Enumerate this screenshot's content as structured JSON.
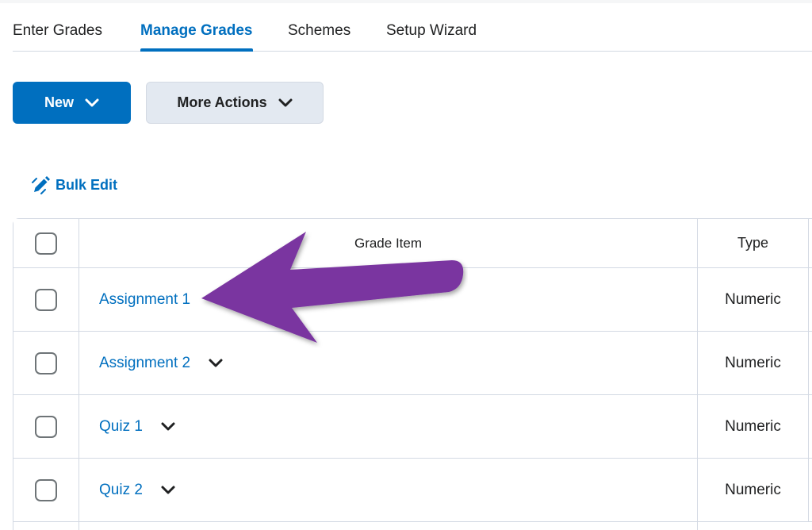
{
  "tabs": [
    {
      "label": "Enter Grades",
      "active": false
    },
    {
      "label": "Manage Grades",
      "active": true
    },
    {
      "label": "Schemes",
      "active": false
    },
    {
      "label": "Setup Wizard",
      "active": false
    }
  ],
  "toolbar": {
    "new_label": "New",
    "more_actions_label": "More Actions"
  },
  "bulk_edit": {
    "label": "Bulk Edit",
    "icon": "pencil-icon"
  },
  "table": {
    "columns": [
      "Grade Item",
      "Type"
    ],
    "rows": [
      {
        "name": "Assignment 1",
        "type": "Numeric",
        "has_menu": false
      },
      {
        "name": "Assignment 2",
        "type": "Numeric",
        "has_menu": true
      },
      {
        "name": "Quiz 1",
        "type": "Numeric",
        "has_menu": true
      },
      {
        "name": "Quiz 2",
        "type": "Numeric",
        "has_menu": true
      }
    ]
  },
  "colors": {
    "accent": "#006fbf",
    "annotation_arrow": "#7a35a0",
    "border": "#d3d9e3",
    "secondary_button": "#e3e9f1"
  }
}
